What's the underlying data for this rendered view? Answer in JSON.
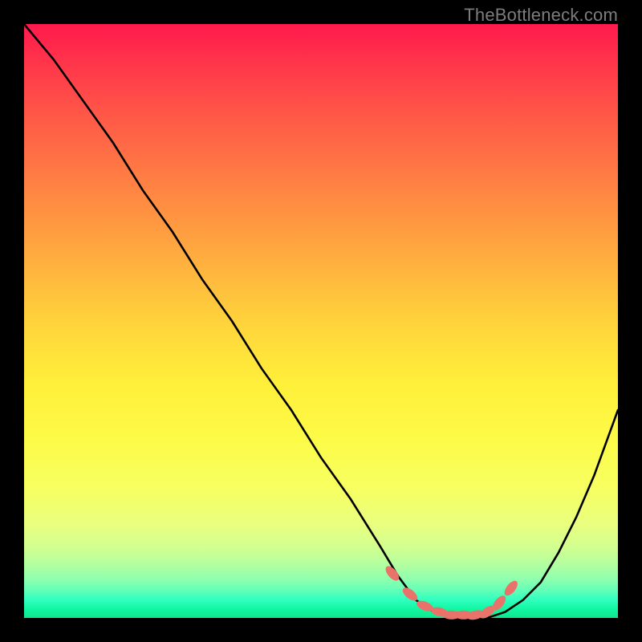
{
  "watermark": "TheBottleneck.com",
  "chart_data": {
    "type": "line",
    "title": "",
    "xlabel": "",
    "ylabel": "",
    "xlim": [
      0,
      100
    ],
    "ylim": [
      0,
      100
    ],
    "grid": false,
    "series": [
      {
        "name": "bottleneck-curve",
        "x": [
          0,
          5,
          10,
          15,
          20,
          25,
          30,
          35,
          40,
          45,
          50,
          55,
          60,
          63,
          66,
          69,
          72,
          75,
          78,
          81,
          84,
          87,
          90,
          93,
          96,
          100
        ],
        "y": [
          100,
          94,
          87,
          80,
          72,
          65,
          57,
          50,
          42,
          35,
          27,
          20,
          12,
          7,
          3,
          1,
          0,
          0,
          0,
          1,
          3,
          6,
          11,
          17,
          24,
          35
        ]
      }
    ],
    "markers": {
      "name": "optimal-range-dots",
      "x": [
        62,
        65,
        67.5,
        70,
        72,
        74,
        76,
        78,
        80,
        82
      ],
      "y": [
        7.5,
        4,
        2,
        1,
        0.5,
        0.5,
        0.5,
        1,
        2.5,
        5
      ]
    },
    "background_gradient": {
      "top": "#ff1a4d",
      "mid": "#ffd93b",
      "bottom": "#11f7a0"
    }
  }
}
